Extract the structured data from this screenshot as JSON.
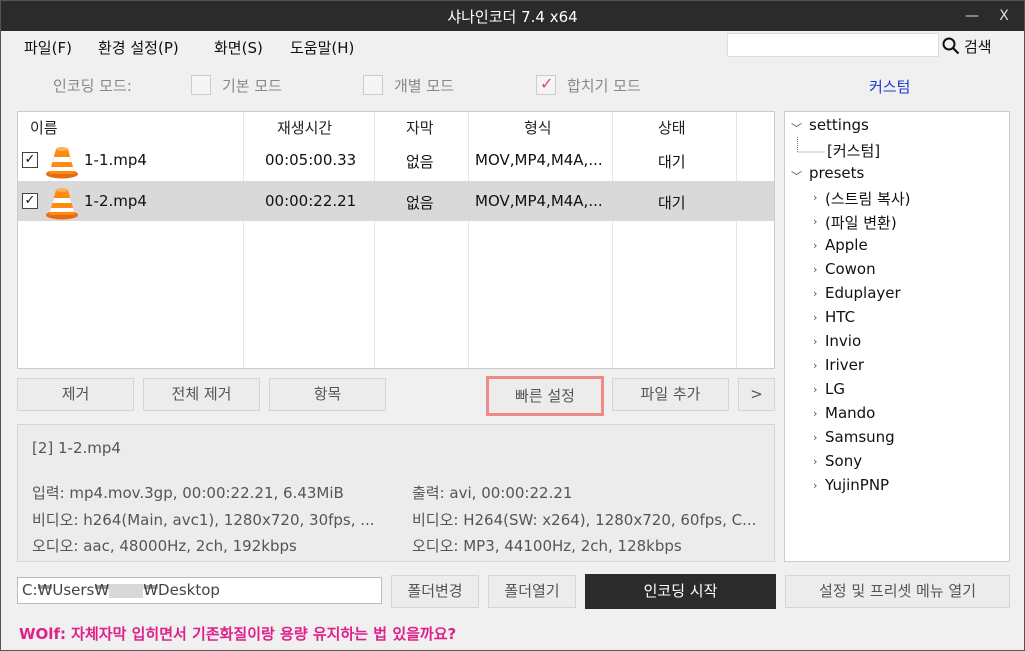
{
  "window": {
    "title": "샤나인코더  7.4 x64",
    "minimize_glyph": "—",
    "close_glyph": "X"
  },
  "menu": {
    "file": "파일(F)",
    "settings": "환경 설정(P)",
    "view": "화면(S)",
    "help": "도움말(H)"
  },
  "search": {
    "value": "",
    "button_label": "검색",
    "icon": "search-icon"
  },
  "encoding_mode": {
    "label": "인코딩 모드:",
    "basic": {
      "label": "기본 모드",
      "checked": false
    },
    "individual": {
      "label": "개별 모드",
      "checked": false
    },
    "merge": {
      "label": "합치기 모드",
      "checked": true
    },
    "custom_link": "커스텀"
  },
  "file_list": {
    "columns": [
      "이름",
      "재생시간",
      "자막",
      "형식",
      "상태"
    ],
    "rows": [
      {
        "checked": true,
        "name": "1-1.mp4",
        "duration": "00:05:00.33",
        "subtitle": "없음",
        "format": "MOV,MP4,M4A,...",
        "status": "대기",
        "selected": false,
        "icon": "vlc-cone-icon"
      },
      {
        "checked": true,
        "name": "1-2.mp4",
        "duration": "00:00:22.21",
        "subtitle": "없음",
        "format": "MOV,MP4,M4A,...",
        "status": "대기",
        "selected": true,
        "icon": "vlc-cone-icon"
      }
    ]
  },
  "buttons": {
    "remove": "제거",
    "remove_all": "전체 제거",
    "items": "항목",
    "quick_settings": "빠른 설정",
    "add_file": "파일 추가",
    "more": ">",
    "change_folder": "폴더변경",
    "open_folder": "폴더열기",
    "start_encoding": "인코딩 시작",
    "open_settings_menu": "설정 및 프리셋 메뉴 열기"
  },
  "info": {
    "header": "[2] 1-2.mp4",
    "input": "입력: mp4.mov.3gp, 00:00:22.21, 6.43MiB",
    "input_video": "비디오: h264(Main, avc1), 1280x720, 30fps, ...",
    "input_audio": "오디오: aac, 48000Hz, 2ch, 192kbps",
    "output": "출력: avi, 00:00:22.21",
    "output_video": "비디오: H264(SW: x264), 1280x720, 60fps, C...",
    "output_audio": "오디오: MP3, 44100Hz, 2ch, 128kbps"
  },
  "tree": {
    "settings": {
      "label": "settings",
      "children": [
        "[커스텀]"
      ]
    },
    "presets": {
      "label": "presets",
      "children": [
        "(스트림 복사)",
        "(파일 변환)",
        "Apple",
        "Cowon",
        "Eduplayer",
        "HTC",
        "Invio",
        "Iriver",
        "LG",
        "Mando",
        "Samsung",
        "Sony",
        "YujinPNP"
      ]
    }
  },
  "output_path": {
    "prefix": "C:₩Users₩",
    "suffix": "₩Desktop"
  },
  "footer": {
    "message": "WOlf: 자체자막 입히면서 기존화질이랑 용량 유지하는 법 있을까요?"
  },
  "colors": {
    "titlebar": "#2b2b2b",
    "accent_link": "#1a3ad0",
    "highlight_border": "#f08a8a",
    "footer_text": "#e0208a",
    "merge_check": "#e0407a"
  }
}
